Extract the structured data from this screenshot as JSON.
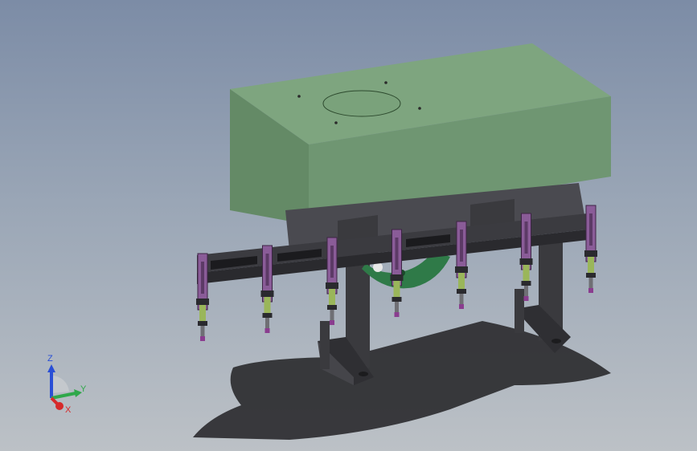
{
  "viewport": {
    "background_top": "#7c8ca6",
    "background_bottom": "#bcc1c6"
  },
  "model": {
    "colors": {
      "housing": "#6f9672",
      "housing_top": "#7ea57f",
      "frame": "#3a3a3e",
      "bracket": "#8a5c98",
      "cam": "#2f7a48",
      "spring": "#9ab65a",
      "tip": "#8a3d8f",
      "shadow": "#2d2d30"
    },
    "picker_count": 7
  },
  "triad": {
    "z_label": "Z",
    "y_label": "Y",
    "x_label": "X",
    "z_color": "#2a4fd6",
    "y_color": "#2fa84a",
    "x_color": "#d62a2a"
  }
}
